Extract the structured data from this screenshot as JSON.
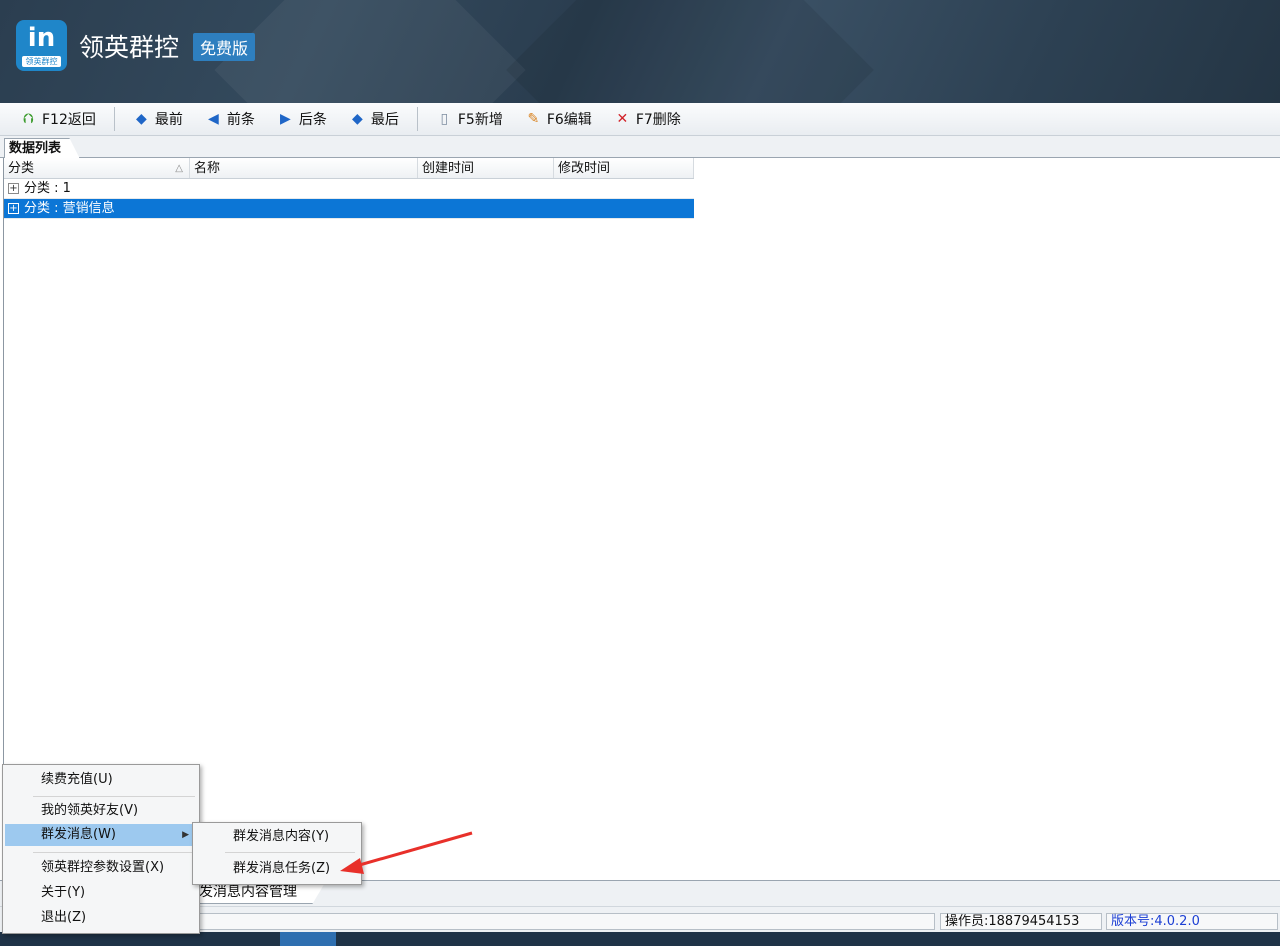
{
  "app": {
    "logo_text": "in",
    "logo_sub": "领英群控",
    "title": "领英群控",
    "edition": "免费版"
  },
  "toolbar": {
    "back": "F12返回",
    "first": "最前",
    "prev": "前条",
    "next": "后条",
    "last": "最后",
    "new": "F5新增",
    "edit": "F6编辑",
    "delete": "F7删除"
  },
  "tabs": {
    "data_list": "数据列表",
    "bottom": "发消息内容管理"
  },
  "grid": {
    "columns": [
      "分类",
      "名称",
      "创建时间",
      "修改时间"
    ],
    "sort_indicator": "△",
    "groups": [
      {
        "label": "分类 : 1",
        "expand": "+",
        "selected": false
      },
      {
        "label": "分类 : 营销信息",
        "expand": "+",
        "selected": true
      }
    ]
  },
  "status": {
    "operator": "操作员:18879454153",
    "version": "版本号:4.0.2.0"
  },
  "menu_main": {
    "items": [
      "续费充值(U)",
      "我的领英好友(V)",
      "群发消息(W)",
      "领英群控参数设置(X)",
      "关于(Y)",
      "退出(Z)"
    ],
    "highlighted": "群发消息(W)"
  },
  "menu_sub": {
    "items": [
      "群发消息内容(Y)",
      "群发消息任务(Z)"
    ]
  },
  "colors": {
    "selection": "#0c76d6",
    "menu_highlight": "#9dc9ef",
    "annotation_arrow": "#e8302a",
    "version_text": "#1c3fd4"
  }
}
